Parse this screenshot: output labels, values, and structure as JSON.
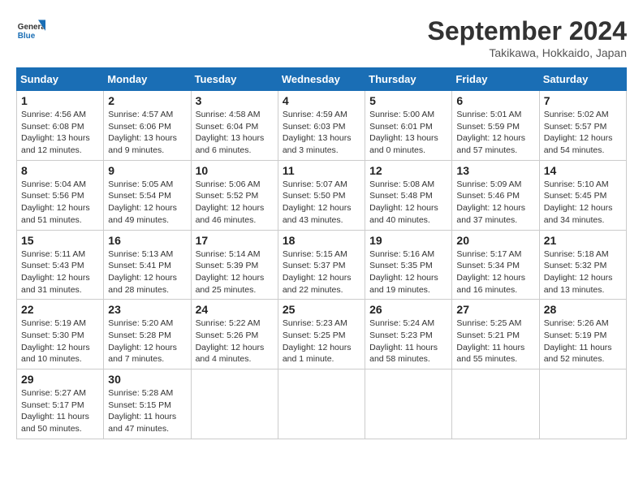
{
  "logo": {
    "text_general": "General",
    "text_blue": "Blue"
  },
  "header": {
    "month": "September 2024",
    "location": "Takikawa, Hokkaido, Japan"
  },
  "weekdays": [
    "Sunday",
    "Monday",
    "Tuesday",
    "Wednesday",
    "Thursday",
    "Friday",
    "Saturday"
  ],
  "weeks": [
    [
      {
        "day": 1,
        "info": "Sunrise: 4:56 AM\nSunset: 6:08 PM\nDaylight: 13 hours and 12 minutes."
      },
      {
        "day": 2,
        "info": "Sunrise: 4:57 AM\nSunset: 6:06 PM\nDaylight: 13 hours and 9 minutes."
      },
      {
        "day": 3,
        "info": "Sunrise: 4:58 AM\nSunset: 6:04 PM\nDaylight: 13 hours and 6 minutes."
      },
      {
        "day": 4,
        "info": "Sunrise: 4:59 AM\nSunset: 6:03 PM\nDaylight: 13 hours and 3 minutes."
      },
      {
        "day": 5,
        "info": "Sunrise: 5:00 AM\nSunset: 6:01 PM\nDaylight: 13 hours and 0 minutes."
      },
      {
        "day": 6,
        "info": "Sunrise: 5:01 AM\nSunset: 5:59 PM\nDaylight: 12 hours and 57 minutes."
      },
      {
        "day": 7,
        "info": "Sunrise: 5:02 AM\nSunset: 5:57 PM\nDaylight: 12 hours and 54 minutes."
      }
    ],
    [
      {
        "day": 8,
        "info": "Sunrise: 5:04 AM\nSunset: 5:56 PM\nDaylight: 12 hours and 51 minutes."
      },
      {
        "day": 9,
        "info": "Sunrise: 5:05 AM\nSunset: 5:54 PM\nDaylight: 12 hours and 49 minutes."
      },
      {
        "day": 10,
        "info": "Sunrise: 5:06 AM\nSunset: 5:52 PM\nDaylight: 12 hours and 46 minutes."
      },
      {
        "day": 11,
        "info": "Sunrise: 5:07 AM\nSunset: 5:50 PM\nDaylight: 12 hours and 43 minutes."
      },
      {
        "day": 12,
        "info": "Sunrise: 5:08 AM\nSunset: 5:48 PM\nDaylight: 12 hours and 40 minutes."
      },
      {
        "day": 13,
        "info": "Sunrise: 5:09 AM\nSunset: 5:46 PM\nDaylight: 12 hours and 37 minutes."
      },
      {
        "day": 14,
        "info": "Sunrise: 5:10 AM\nSunset: 5:45 PM\nDaylight: 12 hours and 34 minutes."
      }
    ],
    [
      {
        "day": 15,
        "info": "Sunrise: 5:11 AM\nSunset: 5:43 PM\nDaylight: 12 hours and 31 minutes."
      },
      {
        "day": 16,
        "info": "Sunrise: 5:13 AM\nSunset: 5:41 PM\nDaylight: 12 hours and 28 minutes."
      },
      {
        "day": 17,
        "info": "Sunrise: 5:14 AM\nSunset: 5:39 PM\nDaylight: 12 hours and 25 minutes."
      },
      {
        "day": 18,
        "info": "Sunrise: 5:15 AM\nSunset: 5:37 PM\nDaylight: 12 hours and 22 minutes."
      },
      {
        "day": 19,
        "info": "Sunrise: 5:16 AM\nSunset: 5:35 PM\nDaylight: 12 hours and 19 minutes."
      },
      {
        "day": 20,
        "info": "Sunrise: 5:17 AM\nSunset: 5:34 PM\nDaylight: 12 hours and 16 minutes."
      },
      {
        "day": 21,
        "info": "Sunrise: 5:18 AM\nSunset: 5:32 PM\nDaylight: 12 hours and 13 minutes."
      }
    ],
    [
      {
        "day": 22,
        "info": "Sunrise: 5:19 AM\nSunset: 5:30 PM\nDaylight: 12 hours and 10 minutes."
      },
      {
        "day": 23,
        "info": "Sunrise: 5:20 AM\nSunset: 5:28 PM\nDaylight: 12 hours and 7 minutes."
      },
      {
        "day": 24,
        "info": "Sunrise: 5:22 AM\nSunset: 5:26 PM\nDaylight: 12 hours and 4 minutes."
      },
      {
        "day": 25,
        "info": "Sunrise: 5:23 AM\nSunset: 5:25 PM\nDaylight: 12 hours and 1 minute."
      },
      {
        "day": 26,
        "info": "Sunrise: 5:24 AM\nSunset: 5:23 PM\nDaylight: 11 hours and 58 minutes."
      },
      {
        "day": 27,
        "info": "Sunrise: 5:25 AM\nSunset: 5:21 PM\nDaylight: 11 hours and 55 minutes."
      },
      {
        "day": 28,
        "info": "Sunrise: 5:26 AM\nSunset: 5:19 PM\nDaylight: 11 hours and 52 minutes."
      }
    ],
    [
      {
        "day": 29,
        "info": "Sunrise: 5:27 AM\nSunset: 5:17 PM\nDaylight: 11 hours and 50 minutes."
      },
      {
        "day": 30,
        "info": "Sunrise: 5:28 AM\nSunset: 5:15 PM\nDaylight: 11 hours and 47 minutes."
      },
      null,
      null,
      null,
      null,
      null
    ]
  ]
}
